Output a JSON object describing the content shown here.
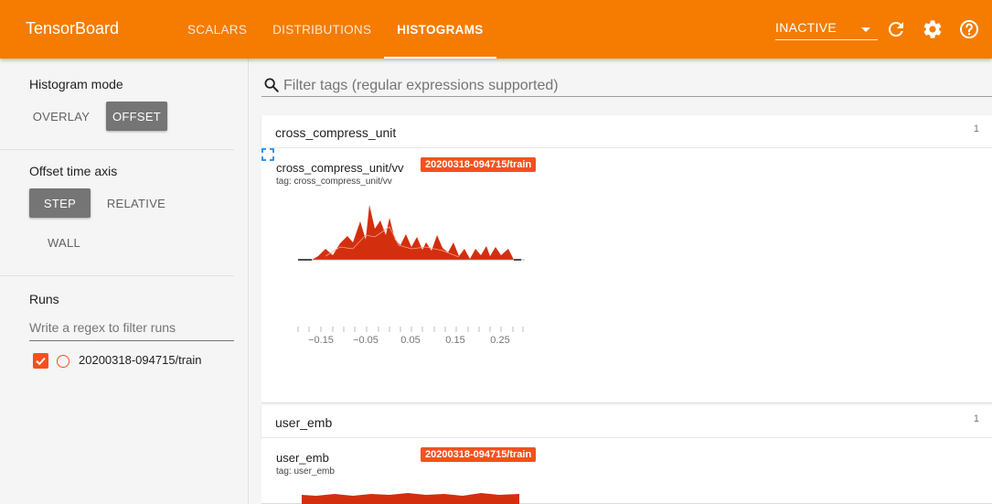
{
  "app": {
    "title": "TensorBoard"
  },
  "tabs": [
    {
      "label": "SCALARS",
      "active": false
    },
    {
      "label": "DISTRIBUTIONS",
      "active": false
    },
    {
      "label": "HISTOGRAMS",
      "active": true
    }
  ],
  "header": {
    "reload_select": "INACTIVE",
    "icons": [
      "refresh-icon",
      "settings-icon",
      "help-icon"
    ]
  },
  "sidebar": {
    "histogram_mode": {
      "title": "Histogram mode",
      "options": [
        "OVERLAY",
        "OFFSET"
      ],
      "selected": "OFFSET"
    },
    "offset_axis": {
      "title": "Offset time axis",
      "options": [
        "STEP",
        "RELATIVE",
        "WALL"
      ],
      "selected": "STEP"
    },
    "runs": {
      "title": "Runs",
      "filter_placeholder": "Write a regex to filter runs",
      "items": [
        {
          "name": "20200318-094715/train",
          "checked": true
        }
      ]
    }
  },
  "main": {
    "filter_placeholder": "Filter tags (regular expressions supported)",
    "categories": [
      {
        "name": "cross_compress_unit",
        "count": "1",
        "card": {
          "title": "cross_compress_unit/vv",
          "run": "20200318-094715/train",
          "tag": "tag: cross_compress_unit/vv",
          "x_ticks": [
            "−0.15",
            "−0.05",
            "0.05",
            "0.15",
            "0.25"
          ]
        }
      },
      {
        "name": "user_emb",
        "count": "1",
        "card": {
          "title": "user_emb",
          "run": "20200318-094715/train",
          "tag": "tag: user_emb"
        }
      }
    ]
  },
  "colors": {
    "primary": "#f57c00",
    "accent": "#f4511e",
    "histogram": "#d32f0e"
  }
}
